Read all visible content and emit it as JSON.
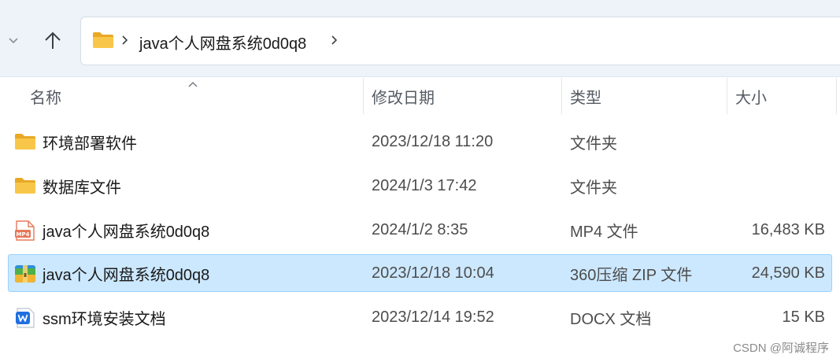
{
  "address": {
    "path_text": "java个人网盘系统0d0q8"
  },
  "columns": {
    "name": "名称",
    "date": "修改日期",
    "type": "类型",
    "size": "大小"
  },
  "files": [
    {
      "name": "环境部署软件",
      "date": "2023/12/18 11:20",
      "type": "文件夹",
      "size": "",
      "icon": "folder-icon"
    },
    {
      "name": "数据库文件",
      "date": "2024/1/3 17:42",
      "type": "文件夹",
      "size": "",
      "icon": "folder-icon"
    },
    {
      "name": "java个人网盘系统0d0q8",
      "date": "2024/1/2 8:35",
      "type": "MP4 文件",
      "size": "16,483 KB",
      "icon": "mp4-file-icon"
    },
    {
      "name": "java个人网盘系统0d0q8",
      "date": "2023/12/18 10:04",
      "type": "360压缩 ZIP 文件",
      "size": "24,590 KB",
      "icon": "zip-archive-icon",
      "selected": true
    },
    {
      "name": "ssm环境安装文档",
      "date": "2023/12/14 19:52",
      "type": "DOCX 文档",
      "size": "15 KB",
      "icon": "wps-document-icon"
    }
  ],
  "watermark": "CSDN @阿诚程序",
  "colors": {
    "selection_bg": "#cce8ff",
    "selection_border": "#99d1ff",
    "folder_yellow": "#f8c74a",
    "topbar_bg": "#eef3f9"
  }
}
